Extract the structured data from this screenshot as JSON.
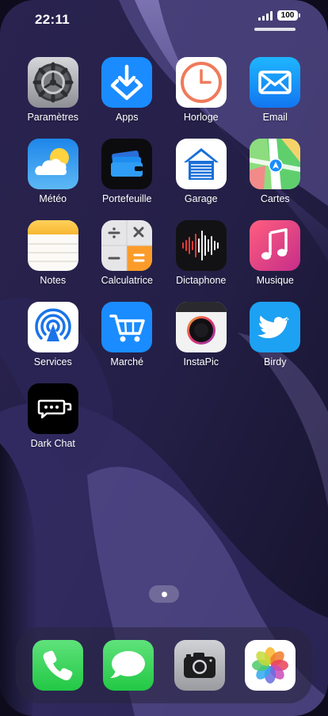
{
  "status_bar": {
    "time": "22:11",
    "battery": "100",
    "icons": [
      "signal-icon",
      "battery-icon"
    ]
  },
  "apps": [
    {
      "label": "Paramètres",
      "icon": "settings-gear-icon"
    },
    {
      "label": "Apps",
      "icon": "app-store-icon"
    },
    {
      "label": "Horloge",
      "icon": "clock-icon"
    },
    {
      "label": "Email",
      "icon": "mail-envelope-icon"
    },
    {
      "label": "Météo",
      "icon": "weather-sun-cloud-icon"
    },
    {
      "label": "Portefeuille",
      "icon": "wallet-icon"
    },
    {
      "label": "Garage",
      "icon": "garage-icon"
    },
    {
      "label": "Cartes",
      "icon": "maps-icon"
    },
    {
      "label": "Notes",
      "icon": "notes-icon"
    },
    {
      "label": "Calculatrice",
      "icon": "calculator-icon"
    },
    {
      "label": "Dictaphone",
      "icon": "voice-memo-waveform-icon"
    },
    {
      "label": "Musique",
      "icon": "music-note-icon"
    },
    {
      "label": "Services",
      "icon": "airdrop-signal-icon"
    },
    {
      "label": "Marché",
      "icon": "shopping-cart-icon"
    },
    {
      "label": "InstaPic",
      "icon": "camera-lens-icon"
    },
    {
      "label": "Birdy",
      "icon": "bird-icon"
    },
    {
      "label": "Dark Chat",
      "icon": "chat-bubble-icon"
    }
  ],
  "dock": [
    {
      "name": "phone",
      "icon": "phone-handset-icon"
    },
    {
      "name": "messages",
      "icon": "message-bubble-icon"
    },
    {
      "name": "camera",
      "icon": "camera-icon"
    },
    {
      "name": "photos",
      "icon": "photos-flower-icon"
    }
  ],
  "page_indicator": {
    "pages": 1,
    "current": 1
  },
  "colors": {
    "wallpaper_base": "#1b1738",
    "wallpaper_accent": "#8a7cc6",
    "accent_blue": "#1a8cff",
    "green": "#31d158"
  }
}
